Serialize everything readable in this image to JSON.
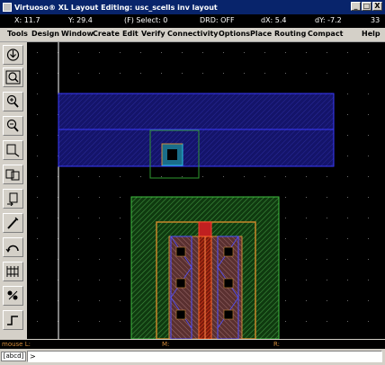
{
  "window": {
    "title": "Virtuoso® XL Layout Editing: usc_scells inv layout",
    "buttons": [
      "_",
      "□",
      "X"
    ]
  },
  "status": {
    "x": "X: 11.7",
    "y": "Y: 29.4",
    "select": "(F) Select: 0",
    "drd": "DRD: OFF",
    "dx": "dX: 5.4",
    "dy": "dY: -7.2",
    "counter": "33"
  },
  "menu": {
    "tools": "Tools",
    "design": "Design",
    "window": "Window",
    "create": "Create",
    "edit": "Edit",
    "verify": "Verify",
    "connectivity": "Connectivity",
    "options": "Options",
    "place": "Place",
    "routing": "Routing",
    "compact": "Compact",
    "help": "Help"
  },
  "toolbar": {
    "icons": [
      "save-icon",
      "fit-view-icon",
      "zoom-in-icon",
      "zoom-out-icon",
      "stretch-icon",
      "copy-icon",
      "move-icon",
      "delete-icon",
      "undo-icon",
      "ruler-icon",
      "via-icon",
      "path-icon",
      "property-icon"
    ]
  },
  "mouse": {
    "left": "mouse L:",
    "middle": "M:",
    "right": "R:"
  },
  "command": {
    "label": "[abcd]",
    "prompt": ">"
  },
  "colors": {
    "titlebar": "#08246b",
    "canvas": "#000000",
    "metal1_blue": "#1c1c8a",
    "nwell_green": "#2f7a2f",
    "poly_red": "#d43c1c",
    "diffusion_orange": "#c8862a"
  }
}
